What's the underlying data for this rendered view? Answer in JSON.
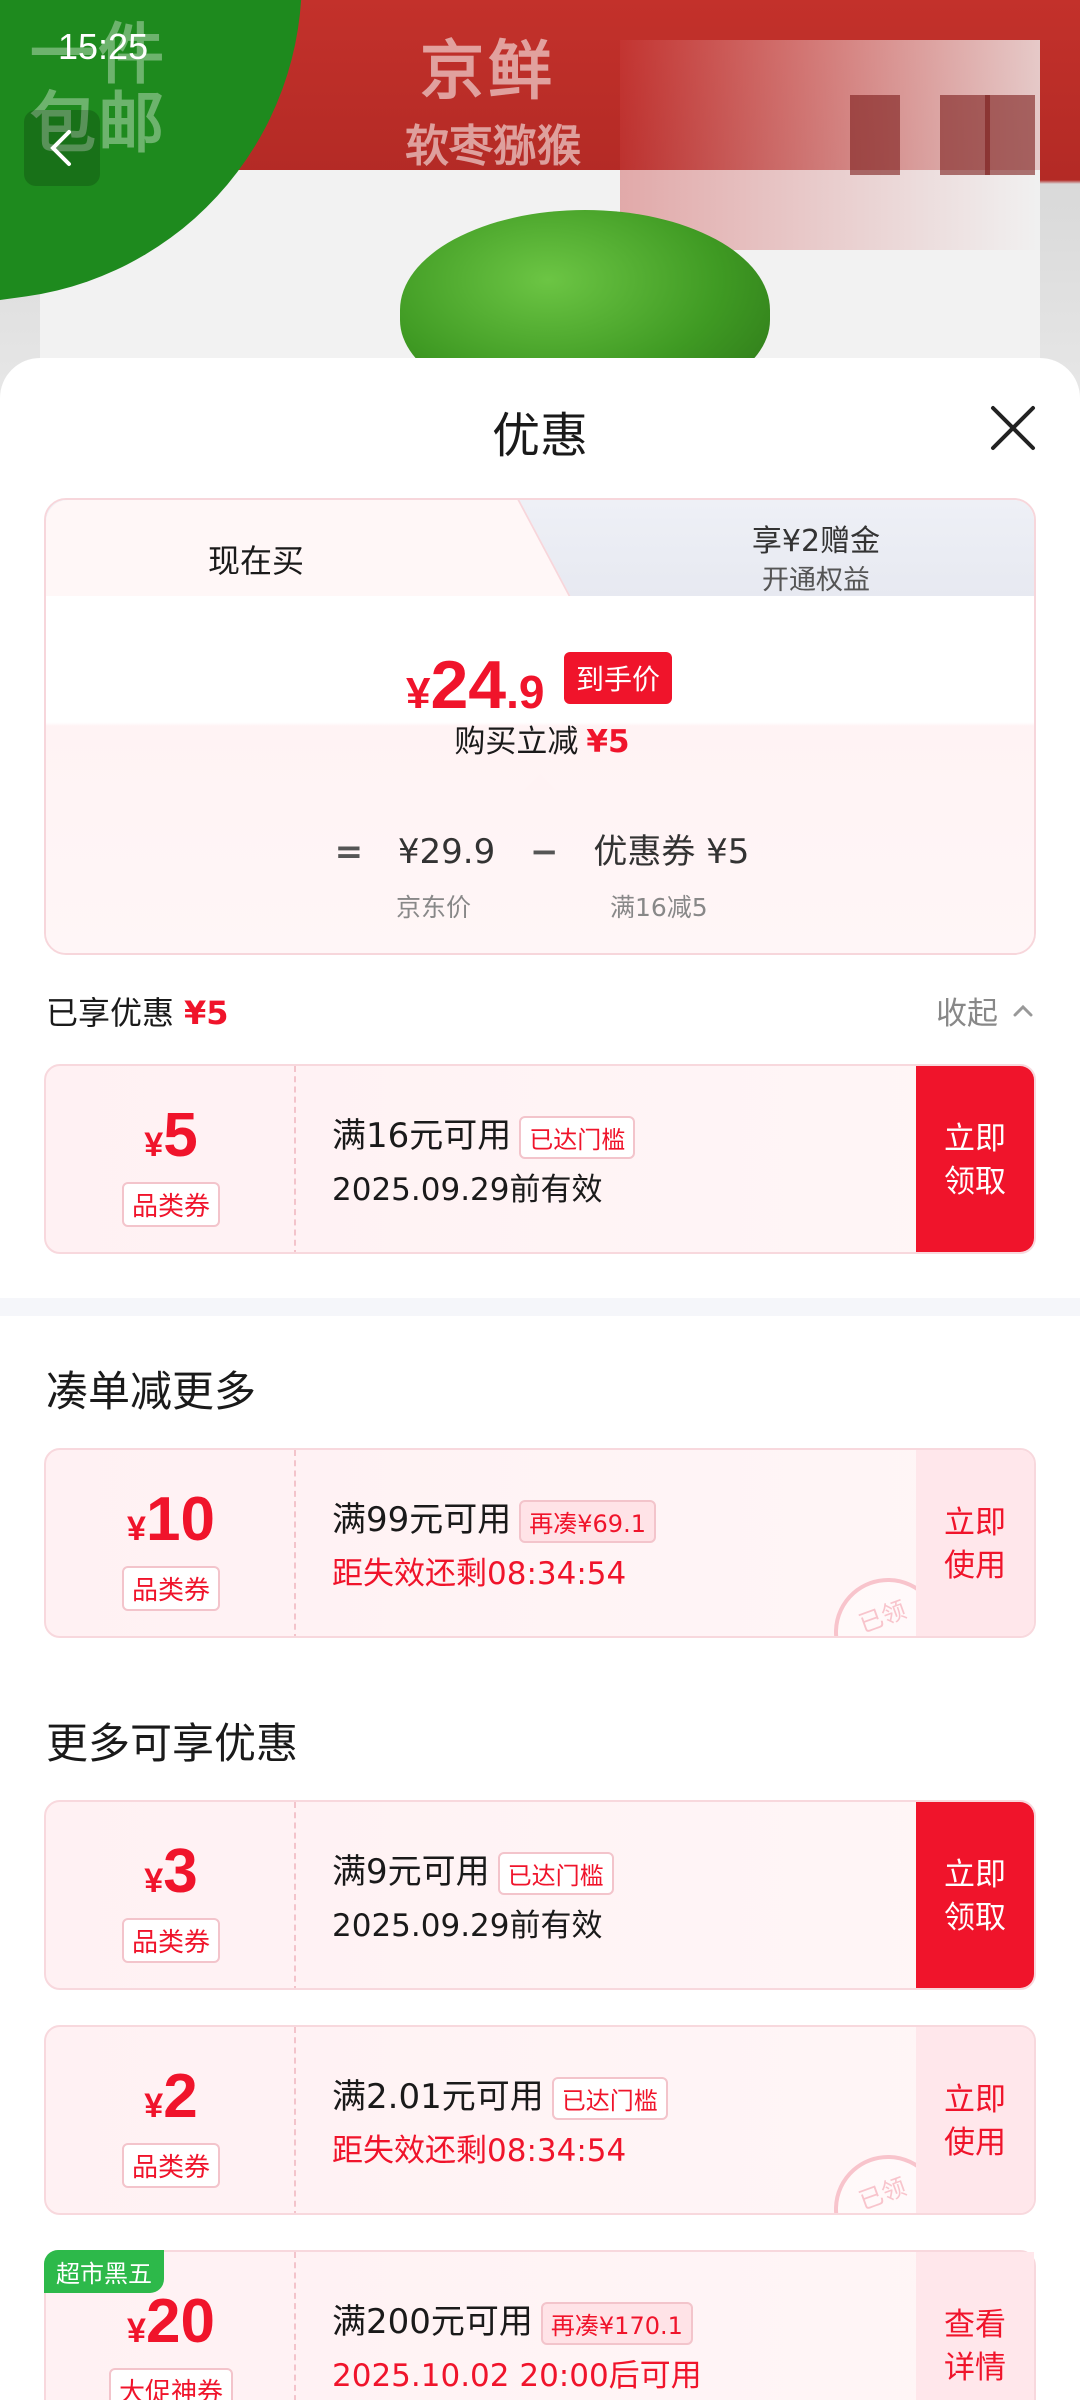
{
  "status_bar": {
    "time": "15:25"
  },
  "hero": {
    "ribbon_line1": "一件",
    "ribbon_line2": "包邮",
    "brand": "京鲜",
    "brand_sub": "软枣猕猴"
  },
  "sheet": {
    "title": "优惠",
    "tabs": [
      {
        "label": "现在买",
        "active": true
      },
      {
        "label": "享¥2赠金",
        "sublabel": "开通权益",
        "active": false
      }
    ],
    "price": {
      "currency": "¥",
      "integer": "24",
      "decimal": ".9",
      "badge": "到手价",
      "reduce_text": "购买立减",
      "reduce_amount": "¥5"
    },
    "formula": {
      "eq": "=",
      "original_price": "¥29.9",
      "minus": "−",
      "coupon_text": "优惠券 ¥5",
      "original_label": "京东价",
      "coupon_label": "满16减5"
    },
    "enjoyed": {
      "label": "已享优惠",
      "amount": "¥5",
      "collapse": "收起"
    },
    "coupons_applied": [
      {
        "currency": "¥",
        "amount": "5",
        "type": "品类券",
        "condition": "满16元可用",
        "tag": "已达门槛",
        "valid": "2025.09.29前有效",
        "action": "立即领取",
        "action_line1": "立即",
        "action_line2": "领取"
      }
    ],
    "section_more_order": "凑单减更多",
    "coupons_more_order": [
      {
        "currency": "¥",
        "amount": "10",
        "type": "品类券",
        "condition": "满99元可用",
        "tag": "再凑¥69.1",
        "valid": "距失效还剩08:34:54",
        "action_line1": "立即",
        "action_line2": "使用",
        "stamp": "已领"
      }
    ],
    "section_more_discounts": "更多可享优惠",
    "coupons_more_discounts": [
      {
        "currency": "¥",
        "amount": "3",
        "type": "品类券",
        "condition": "满9元可用",
        "tag": "已达门槛",
        "valid": "2025.09.29前有效",
        "action_line1": "立即",
        "action_line2": "领取"
      },
      {
        "currency": "¥",
        "amount": "2",
        "type": "品类券",
        "condition": "满2.01元可用",
        "tag": "已达门槛",
        "valid": "距失效还剩08:34:54",
        "action_line1": "立即",
        "action_line2": "使用",
        "stamp": "已领"
      },
      {
        "promo_badge": "超市黑五",
        "currency": "¥",
        "amount": "20",
        "type": "大促神券",
        "condition": "满200元可用",
        "tag": "再凑¥170.1",
        "valid": "2025.10.02 20:00后可用",
        "action_line1": "查看",
        "action_line2": "详情"
      }
    ]
  },
  "colors": {
    "accent_red": "#f0142b",
    "coupon_bg": "#fff1f3",
    "green_badge": "#2db94a"
  }
}
